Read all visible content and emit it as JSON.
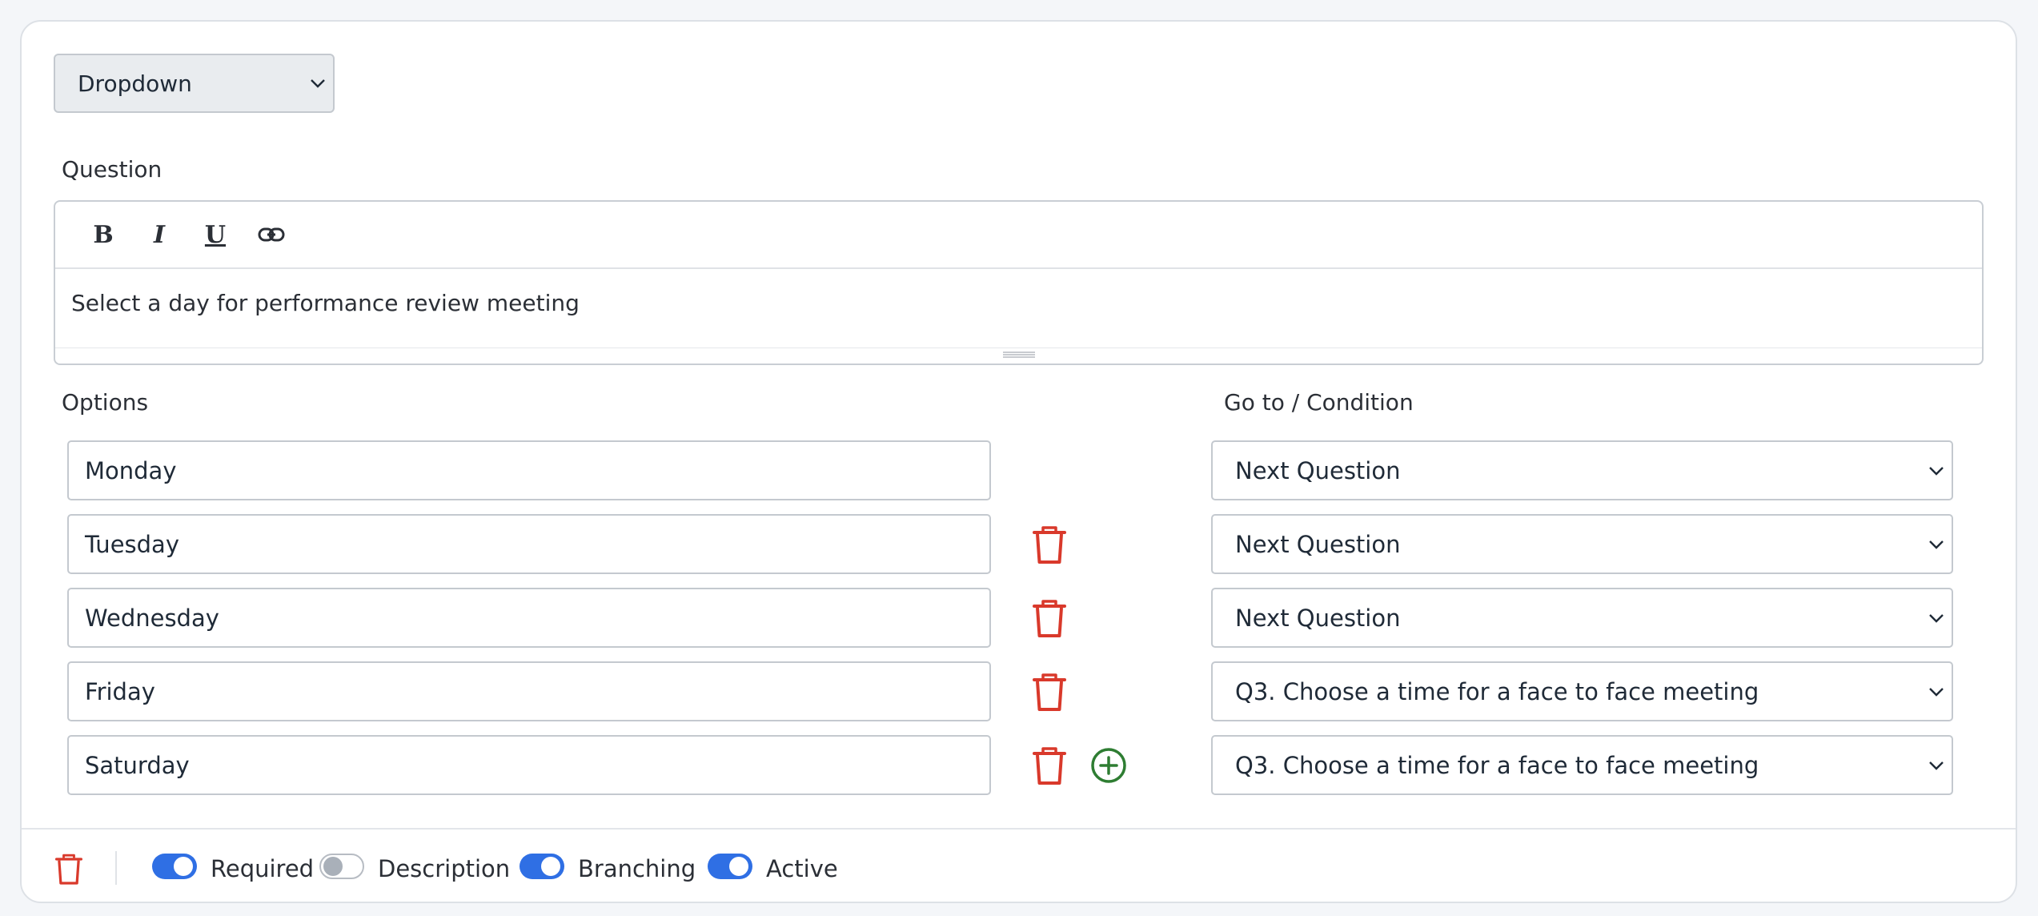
{
  "question_type": {
    "selected": "Dropdown"
  },
  "question": {
    "label": "Question",
    "toolbar": {
      "bold": "B",
      "italic": "I",
      "underline": "U"
    },
    "text": "Select a day for performance review meeting"
  },
  "options": {
    "label": "Options",
    "goto_label": "Go to / Condition",
    "rows": [
      {
        "value": "Monday",
        "goto": "Next Question",
        "deletable": false,
        "addable": false
      },
      {
        "value": "Tuesday",
        "goto": "Next Question",
        "deletable": true,
        "addable": false
      },
      {
        "value": "Wednesday",
        "goto": "Next Question",
        "deletable": true,
        "addable": false
      },
      {
        "value": "Friday",
        "goto": "Q3. Choose a time for a face to face meeting",
        "deletable": true,
        "addable": false
      },
      {
        "value": "Saturday",
        "goto": "Q3. Choose a time for a face to face meeting",
        "deletable": true,
        "addable": true
      }
    ]
  },
  "footer": {
    "toggles": [
      {
        "label": "Required",
        "on": true
      },
      {
        "label": "Description",
        "on": false
      },
      {
        "label": "Branching",
        "on": true
      },
      {
        "label": "Active",
        "on": true
      }
    ]
  },
  "colors": {
    "accent": "#2f6fe4",
    "danger": "#d9392b",
    "success": "#2e7d32"
  }
}
